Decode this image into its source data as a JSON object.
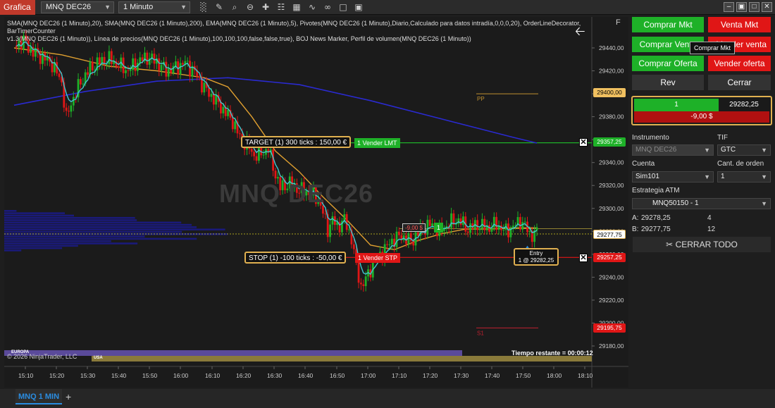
{
  "toolbar": {
    "brand": "Grafica",
    "instrument": "MNQ DEC26",
    "interval": "1 Minuto",
    "icons": [
      "bars-icon",
      "pencil-icon",
      "magnifier-icon",
      "zoom-out-icon",
      "crosshair-icon",
      "properties-icon",
      "strategy-icon",
      "indicator-icon",
      "link-icon",
      "templates-icon",
      "window-linking-icon"
    ],
    "window_buttons": [
      "minimize",
      "restore",
      "maximize",
      "close"
    ]
  },
  "chart": {
    "indicators_line1": "SMA(MNQ DEC26 (1 Minuto),20), SMA(MNQ DEC26 (1 Minuto),200), EMA(MNQ DEC26 (1 Minuto),5), Pivotes(MNQ DEC26 (1 Minuto),Diario,Calculado para datos intradía,0,0,0,20), OrderLineDecorator, BarTimerCounter",
    "indicators_line2": "v1.3(MNQ DEC26 (1 Minuto)), Línea de precios(MNQ DEC26 (1 Minuto),100,100,100,false,false,true), BOJ News Marker, Perfil de volumen(MNQ DEC26 (1 Minuto))",
    "watermark": "MNQ DEC26",
    "f_button": "F",
    "copyright": "© 2026 NinjaTrader, LLC",
    "remaining": "Tiempo restante = 00:00:12",
    "session_europe": "EUROPA",
    "session_usa": "USA",
    "pp_label": "PP",
    "s1_label": "S1",
    "target_box": "TARGET (1) 300 ticks : 150,00 €",
    "target_tag": "1  Vender LMT",
    "stop_box": "STOP (1) -100 ticks : -50,00 €",
    "stop_tag": "1  Vender STP",
    "pl_tag": "-9,00 $",
    "pl_qty": "1",
    "entry_label": "Entry",
    "entry_detail": "1 @ 29282,25",
    "price_boxes": {
      "pp": "29400,00",
      "target": "29357,25",
      "last": "29277,75",
      "stop": "29257,25",
      "s1": "29195,75"
    },
    "colors": {
      "bull": "#1eb128",
      "bear": "#e01616",
      "sma20": "#e0a030",
      "sma200": "#2a2ad0",
      "ema5": "#40c8d0",
      "target": "#1eb128",
      "stop": "#e01616"
    }
  },
  "chart_data": {
    "type": "candlestick",
    "title": "",
    "xlabel": "",
    "ylabel": "",
    "ylim": [
      29170,
      29460
    ],
    "y_ticks": [
      "29440,00",
      "29420,00",
      "29400,00",
      "29380,00",
      "29360,00",
      "29340,00",
      "29320,00",
      "29300,00",
      "29280,00",
      "29260,00",
      "29240,00",
      "29220,00",
      "29200,00",
      "29180,00"
    ],
    "y_tick_values": [
      29440,
      29420,
      29400,
      29380,
      29360,
      29340,
      29320,
      29300,
      29280,
      29260,
      29240,
      29220,
      29200,
      29180
    ],
    "x_ticks": [
      "15:10",
      "15:20",
      "15:30",
      "15:40",
      "15:50",
      "16:00",
      "16:10",
      "16:20",
      "16:30",
      "16:40",
      "16:50",
      "17:00",
      "17:10",
      "17:20",
      "17:30",
      "17:40",
      "17:50",
      "18:00",
      "18:10"
    ],
    "levels": {
      "pp": 29400.0,
      "target": 29357.25,
      "last": 29277.75,
      "entry": 29282.25,
      "stop": 29257.25,
      "s1": 29195.75
    },
    "price_path": [
      [
        0,
        29442
      ],
      [
        8,
        29446
      ],
      [
        16,
        29436
      ],
      [
        24,
        29432
      ],
      [
        32,
        29426
      ],
      [
        40,
        29410
      ],
      [
        44,
        29378
      ],
      [
        48,
        29392
      ],
      [
        56,
        29410
      ],
      [
        64,
        29422
      ],
      [
        72,
        29428
      ],
      [
        80,
        29430
      ],
      [
        88,
        29425
      ],
      [
        96,
        29420
      ],
      [
        104,
        29428
      ],
      [
        112,
        29432
      ],
      [
        120,
        29428
      ],
      [
        128,
        29420
      ],
      [
        136,
        29423
      ],
      [
        144,
        29427
      ],
      [
        152,
        29419
      ],
      [
        160,
        29405
      ],
      [
        168,
        29396
      ],
      [
        176,
        29386
      ],
      [
        184,
        29376
      ],
      [
        190,
        29362
      ],
      [
        196,
        29356
      ],
      [
        202,
        29346
      ],
      [
        208,
        29348
      ],
      [
        214,
        29352
      ],
      [
        218,
        29336
      ],
      [
        224,
        29318
      ],
      [
        232,
        29322
      ],
      [
        240,
        29316
      ],
      [
        248,
        29314
      ],
      [
        256,
        29308
      ],
      [
        260,
        29296
      ],
      [
        264,
        29282
      ],
      [
        268,
        29290
      ],
      [
        272,
        29284
      ],
      [
        278,
        29290
      ],
      [
        284,
        29274
      ],
      [
        288,
        29250
      ],
      [
        292,
        29232
      ],
      [
        296,
        29238
      ],
      [
        302,
        29252
      ],
      [
        310,
        29262
      ],
      [
        318,
        29272
      ],
      [
        326,
        29276
      ],
      [
        334,
        29271
      ],
      [
        342,
        29281
      ],
      [
        350,
        29286
      ],
      [
        358,
        29280
      ],
      [
        366,
        29287
      ],
      [
        374,
        29290
      ],
      [
        382,
        29282
      ],
      [
        390,
        29286
      ],
      [
        398,
        29283
      ],
      [
        406,
        29286
      ],
      [
        414,
        29280
      ],
      [
        420,
        29284
      ],
      [
        426,
        29289
      ],
      [
        430,
        29285
      ],
      [
        434,
        29277
      ],
      [
        440,
        29279
      ]
    ],
    "sma20_path": [
      [
        0,
        29440
      ],
      [
        40,
        29434
      ],
      [
        80,
        29424
      ],
      [
        120,
        29420
      ],
      [
        160,
        29414
      ],
      [
        180,
        29406
      ],
      [
        200,
        29380
      ],
      [
        220,
        29350
      ],
      [
        240,
        29332
      ],
      [
        260,
        29310
      ],
      [
        280,
        29290
      ],
      [
        300,
        29268
      ],
      [
        320,
        29264
      ],
      [
        340,
        29272
      ],
      [
        360,
        29278
      ],
      [
        380,
        29282
      ],
      [
        400,
        29282
      ],
      [
        420,
        29283
      ],
      [
        440,
        29283
      ]
    ],
    "sma200_path": [
      [
        0,
        29390
      ],
      [
        60,
        29402
      ],
      [
        120,
        29411
      ],
      [
        180,
        29414
      ],
      [
        240,
        29408
      ],
      [
        300,
        29394
      ],
      [
        360,
        29378
      ],
      [
        420,
        29362
      ],
      [
        440,
        29357
      ]
    ],
    "volume_profile_rows": 18,
    "volume_profile_max_pct": 40
  },
  "panel": {
    "buy_mkt": "Comprar Mkt",
    "sell_mkt": "Venta Mkt",
    "buy_bid": "Comprar Venta",
    "sell_ask": "Vender venta",
    "buy_ask": "Comprar Oferta",
    "sell_bid": "Vender oferta",
    "tooltip": "Comprar Mkt",
    "rev": "Rev",
    "close": "Cerrar",
    "position_qty": "1",
    "position_avg": "29282,25",
    "position_pnl": "-9,00 $",
    "instrument_label": "Instrumento",
    "instrument_value": "MNQ DEC26",
    "tif_label": "TIF",
    "tif_value": "GTC",
    "account_label": "Cuenta",
    "account_value": "Sim101",
    "qty_label": "Cant. de orden",
    "qty_value": "1",
    "atm_label": "Estrategia ATM",
    "atm_value": "MNQ50150 - 1",
    "ask_label": "A:",
    "ask_price": "29278,25",
    "ask_size": "4",
    "bid_label": "B:",
    "bid_price": "29277,75",
    "bid_size": "12",
    "close_all": "CERRAR TODO"
  },
  "tabs": {
    "active": "MNQ 1 MIN",
    "add": "+"
  }
}
